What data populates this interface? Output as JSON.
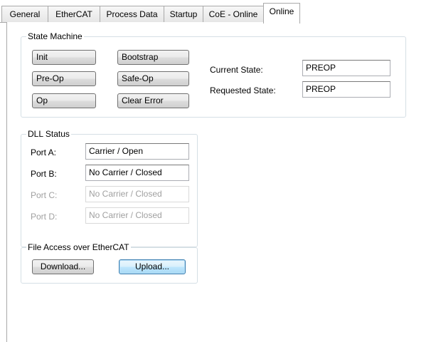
{
  "tabs": [
    {
      "label": "General"
    },
    {
      "label": "EtherCAT"
    },
    {
      "label": "Process Data"
    },
    {
      "label": "Startup"
    },
    {
      "label": "CoE - Online"
    },
    {
      "label": "Online",
      "active": true
    }
  ],
  "state_machine": {
    "title": "State Machine",
    "buttons": {
      "init": "Init",
      "bootstrap": "Bootstrap",
      "preop": "Pre-Op",
      "safeop": "Safe-Op",
      "op": "Op",
      "clear_error": "Clear Error"
    },
    "current_state_label": "Current State:",
    "current_state_value": "PREOP",
    "requested_state_label": "Requested State:",
    "requested_state_value": "PREOP"
  },
  "dll_status": {
    "title": "DLL Status",
    "ports": [
      {
        "label": "Port A:",
        "value": "Carrier / Open",
        "enabled": true
      },
      {
        "label": "Port B:",
        "value": "No Carrier / Closed",
        "enabled": true
      },
      {
        "label": "Port C:",
        "value": "No Carrier / Closed",
        "enabled": false
      },
      {
        "label": "Port D:",
        "value": "No Carrier / Closed",
        "enabled": false
      }
    ]
  },
  "file_access": {
    "title": "File Access over EtherCAT",
    "download_label": "Download...",
    "upload_label": "Upload..."
  }
}
